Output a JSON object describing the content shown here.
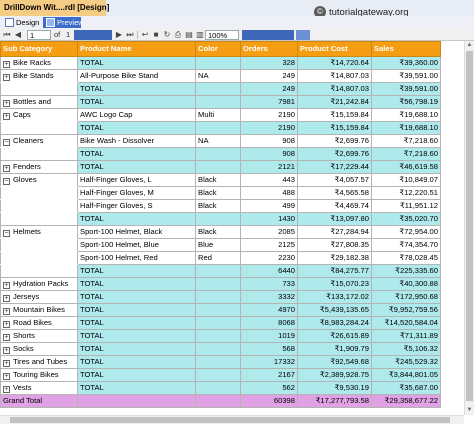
{
  "document_tab": {
    "title": "DrillDown Wit....rdl [Design]"
  },
  "watermark": {
    "logo": "©",
    "text": "tutorialgateway.org"
  },
  "view_tabs": [
    {
      "label": "Design",
      "active": false
    },
    {
      "label": "Preview",
      "active": true
    }
  ],
  "toolbar": {
    "page_current": "1",
    "page_of": "of",
    "page_total": "1",
    "zoom": "100%"
  },
  "table": {
    "columns": [
      "Sub Category",
      "Product Name",
      "Color",
      "Orders",
      "Product Cost",
      "Sales"
    ],
    "rows": [
      {
        "expand": "+",
        "sub": "Bike Racks",
        "product": "TOTAL",
        "color": "",
        "orders": "328",
        "cost": "₹14,720.64",
        "sales": "₹39,360.00",
        "total": true
      },
      {
        "expand": "+",
        "sub": "Bike Stands",
        "product": "All-Purpose Bike Stand",
        "color": "NA",
        "orders": "249",
        "cost": "₹14,807.03",
        "sales": "₹39,591.00",
        "total": false
      },
      {
        "expand": "",
        "sub": "",
        "product": "TOTAL",
        "color": "",
        "orders": "249",
        "cost": "₹14,807.03",
        "sales": "₹39,591.00",
        "total": true
      },
      {
        "expand": "+",
        "sub": "Bottles and",
        "product": "TOTAL",
        "color": "",
        "orders": "7981",
        "cost": "₹21,242.84",
        "sales": "₹56,798.19",
        "total": true
      },
      {
        "expand": "+",
        "sub": "Caps",
        "product": "AWC Logo Cap",
        "color": "Multi",
        "orders": "2190",
        "cost": "₹15,159.84",
        "sales": "₹19,688.10",
        "total": false
      },
      {
        "expand": "",
        "sub": "",
        "product": "TOTAL",
        "color": "",
        "orders": "2190",
        "cost": "₹15,159.84",
        "sales": "₹19,688.10",
        "total": true
      },
      {
        "expand": "−",
        "sub": "Cleaners",
        "product": "Bike Wash - Dissolver",
        "color": "NA",
        "orders": "908",
        "cost": "₹2,699.76",
        "sales": "₹7,218.60",
        "total": false
      },
      {
        "expand": "",
        "sub": "",
        "product": "TOTAL",
        "color": "",
        "orders": "908",
        "cost": "₹2,699.76",
        "sales": "₹7,218.60",
        "total": true
      },
      {
        "expand": "+",
        "sub": "Fenders",
        "product": "TOTAL",
        "color": "",
        "orders": "2121",
        "cost": "₹17,229.44",
        "sales": "₹46,619.58",
        "total": true
      },
      {
        "expand": "−",
        "sub": "Gloves",
        "product": "Half-Finger Gloves, L",
        "color": "Black",
        "orders": "443",
        "cost": "₹4,057.57",
        "sales": "₹10,849.07",
        "total": false
      },
      {
        "expand": "",
        "sub": "",
        "product": "Half-Finger Gloves, M",
        "color": "Black",
        "orders": "488",
        "cost": "₹4,565.58",
        "sales": "₹12,220.51",
        "total": false
      },
      {
        "expand": "",
        "sub": "",
        "product": "Half-Finger Gloves, S",
        "color": "Black",
        "orders": "499",
        "cost": "₹4,469.74",
        "sales": "₹11,951.12",
        "total": false
      },
      {
        "expand": "",
        "sub": "",
        "product": "TOTAL",
        "color": "",
        "orders": "1430",
        "cost": "₹13,097.80",
        "sales": "₹35,020.70",
        "total": true
      },
      {
        "expand": "−",
        "sub": "Helmets",
        "product": "Sport-100 Helmet, Black",
        "color": "Black",
        "orders": "2085",
        "cost": "₹27,284.94",
        "sales": "₹72,954.00",
        "total": false
      },
      {
        "expand": "",
        "sub": "",
        "product": "Sport-100 Helmet, Blue",
        "color": "Blue",
        "orders": "2125",
        "cost": "₹27,808.35",
        "sales": "₹74,354.70",
        "total": false
      },
      {
        "expand": "",
        "sub": "",
        "product": "Sport-100 Helmet, Red",
        "color": "Red",
        "orders": "2230",
        "cost": "₹29,182.38",
        "sales": "₹78,028.45",
        "total": false
      },
      {
        "expand": "",
        "sub": "",
        "product": "TOTAL",
        "color": "",
        "orders": "6440",
        "cost": "₹84,275.77",
        "sales": "₹225,335.60",
        "total": true
      },
      {
        "expand": "+",
        "sub": "Hydration Packs",
        "product": "TOTAL",
        "color": "",
        "orders": "733",
        "cost": "₹15,070.23",
        "sales": "₹40,300.88",
        "total": true
      },
      {
        "expand": "+",
        "sub": "Jerseys",
        "product": "TOTAL",
        "color": "",
        "orders": "3332",
        "cost": "₹133,172.02",
        "sales": "₹172,950.68",
        "total": true
      },
      {
        "expand": "+",
        "sub": "Mountain Bikes",
        "product": "TOTAL",
        "color": "",
        "orders": "4970",
        "cost": "₹5,439,135.65",
        "sales": "₹9,952,759.56",
        "total": true
      },
      {
        "expand": "+",
        "sub": "Road Bikes",
        "product": "TOTAL",
        "color": "",
        "orders": "8068",
        "cost": "₹8,983,284.24",
        "sales": "₹14,520,584.04",
        "total": true
      },
      {
        "expand": "+",
        "sub": "Shorts",
        "product": "TOTAL",
        "color": "",
        "orders": "1019",
        "cost": "₹26,615.89",
        "sales": "₹71,311.89",
        "total": true
      },
      {
        "expand": "+",
        "sub": "Socks",
        "product": "TOTAL",
        "color": "",
        "orders": "568",
        "cost": "₹1,909.79",
        "sales": "₹5,106.32",
        "total": true
      },
      {
        "expand": "+",
        "sub": "Tires and Tubes",
        "product": "TOTAL",
        "color": "",
        "orders": "17332",
        "cost": "₹92,549.68",
        "sales": "₹245,529.32",
        "total": true
      },
      {
        "expand": "+",
        "sub": "Touring Bikes",
        "product": "TOTAL",
        "color": "",
        "orders": "2167",
        "cost": "₹2,389,928.75",
        "sales": "₹3,844,801.05",
        "total": true
      },
      {
        "expand": "+",
        "sub": "Vests",
        "product": "TOTAL",
        "color": "",
        "orders": "562",
        "cost": "₹9,530.19",
        "sales": "₹35,687.00",
        "total": true
      }
    ],
    "grand": {
      "label": "Grand Total",
      "orders": "60398",
      "cost": "₹17,277,793.58",
      "sales": "₹29,358,677.22"
    }
  }
}
